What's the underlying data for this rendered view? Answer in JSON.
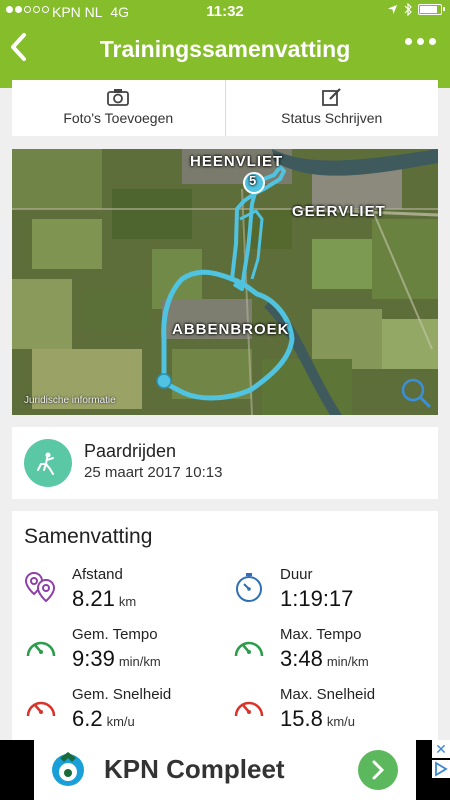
{
  "status_bar": {
    "carrier": "KPN NL",
    "network": "4G",
    "time": "11:32",
    "signal_bars": 2,
    "signal_max": 5,
    "battery_level": 0.9
  },
  "nav": {
    "back_icon": "chevron-left-icon",
    "title": "Trainingssamenvatting",
    "more_icon": "ellipsis-icon"
  },
  "actions": {
    "add_photos": "Foto's Toevoegen",
    "write_status": "Status Schrijven"
  },
  "map": {
    "labels": {
      "heenvliet": "HEENVLIET",
      "geervliet": "GEERVLIET",
      "abbenbroek": "ABBENBROEK"
    },
    "legal": "Juridische informatie",
    "lap_marker": "5"
  },
  "activity": {
    "name": "Paardrijden",
    "date": "25 maart 2017 10:13",
    "icon": "horse-riding-icon"
  },
  "summary": {
    "heading": "Samenvatting",
    "distance": {
      "label": "Afstand",
      "value": "8.21",
      "unit": "km",
      "icon": "route-pins-icon"
    },
    "duration": {
      "label": "Duur",
      "value": "1:19:17",
      "unit": "",
      "icon": "stopwatch-icon"
    },
    "avg_pace": {
      "label": "Gem. Tempo",
      "value": "9:39",
      "unit": "min/km",
      "icon": "speedometer-icon"
    },
    "max_pace": {
      "label": "Max. Tempo",
      "value": "3:48",
      "unit": "min/km",
      "icon": "speedometer-icon"
    },
    "avg_speed": {
      "label": "Gem. Snelheid",
      "value": "6.2",
      "unit": "km/u",
      "icon": "speedometer-icon"
    },
    "max_speed": {
      "label": "Max. Snelheid",
      "value": "15.8",
      "unit": "km/u",
      "icon": "speedometer-icon"
    }
  },
  "ad": {
    "text": "KPN Compleet",
    "close": "✕"
  },
  "colors": {
    "brand_green": "#86bd2a",
    "route": "#4fc3e0",
    "activity_teal": "#5bc8a5",
    "icon_purple": "#8e3fa8",
    "icon_blue": "#2f6fb8",
    "icon_green": "#2a9c4a",
    "icon_red": "#d8342c"
  }
}
